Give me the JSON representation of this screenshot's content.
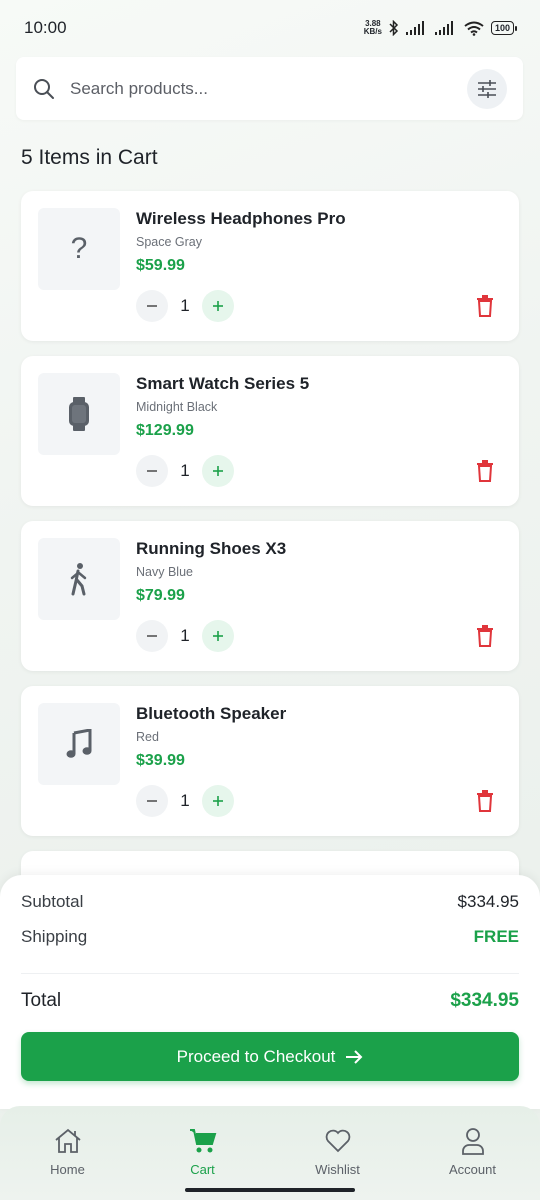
{
  "status_bar": {
    "time": "10:00",
    "net_speed_top": "3.88",
    "net_speed_bottom": "KB/s",
    "battery": "100"
  },
  "search": {
    "placeholder": "Search products..."
  },
  "cart": {
    "heading": "5 Items in Cart",
    "items": [
      {
        "name": "Wireless Headphones Pro",
        "variant": "Space Gray",
        "price": "$59.99",
        "quantity": "1",
        "icon": "question-mark-icon",
        "thumb_glyph": "?"
      },
      {
        "name": "Smart Watch Series 5",
        "variant": "Midnight Black",
        "price": "$129.99",
        "quantity": "1",
        "icon": "watch-icon"
      },
      {
        "name": "Running Shoes X3",
        "variant": "Navy Blue",
        "price": "$79.99",
        "quantity": "1",
        "icon": "walking-person-icon"
      },
      {
        "name": "Bluetooth Speaker",
        "variant": "Red",
        "price": "$39.99",
        "quantity": "1",
        "icon": "music-note-icon"
      }
    ]
  },
  "summary": {
    "subtotal_label": "Subtotal",
    "subtotal_value": "$334.95",
    "shipping_label": "Shipping",
    "shipping_value": "FREE",
    "total_label": "Total",
    "total_value": "$334.95",
    "checkout_label": "Proceed to Checkout"
  },
  "nav": {
    "items": [
      {
        "label": "Home",
        "icon": "home-icon"
      },
      {
        "label": "Cart",
        "icon": "cart-icon",
        "active": true
      },
      {
        "label": "Wishlist",
        "icon": "heart-icon"
      },
      {
        "label": "Account",
        "icon": "account-icon"
      }
    ]
  },
  "colors": {
    "accent": "#1ba14a",
    "delete": "#e0353b",
    "text": "#1f2329"
  }
}
